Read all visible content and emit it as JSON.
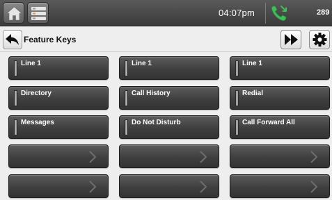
{
  "status_bar": {
    "time": "04:07pm",
    "extension": "289",
    "icons": [
      "home-icon",
      "list-icon",
      "phone-icon"
    ],
    "phone_icon_color": "#3fbf5a"
  },
  "header": {
    "title": "Feature Keys",
    "icons": [
      "back-arrow-icon",
      "fast-forward-icon",
      "gear-icon"
    ]
  },
  "keys": [
    {
      "label": "Line 1",
      "assigned": true
    },
    {
      "label": "Line 1",
      "assigned": true
    },
    {
      "label": "Line 1",
      "assigned": true
    },
    {
      "label": "Directory",
      "assigned": true
    },
    {
      "label": "Call History",
      "assigned": true
    },
    {
      "label": "Redial",
      "assigned": true
    },
    {
      "label": "Messages",
      "assigned": true
    },
    {
      "label": "Do Not Disturb",
      "assigned": true
    },
    {
      "label": "Call Forward All",
      "assigned": true
    },
    {
      "label": "",
      "assigned": false,
      "icon": "chevron-right-icon"
    },
    {
      "label": "",
      "assigned": false,
      "icon": "chevron-right-icon"
    },
    {
      "label": "",
      "assigned": false,
      "icon": "chevron-right-icon"
    },
    {
      "label": "",
      "assigned": false,
      "icon": "chevron-right-icon"
    },
    {
      "label": "",
      "assigned": false,
      "icon": "chevron-right-icon"
    },
    {
      "label": "",
      "assigned": false,
      "icon": "chevron-right-icon"
    }
  ]
}
